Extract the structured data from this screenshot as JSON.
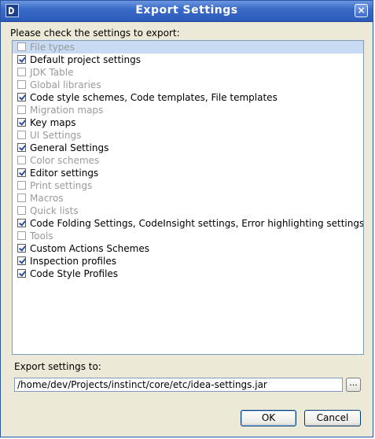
{
  "window": {
    "title": "Export Settings",
    "close_label": "×"
  },
  "prompt": "Please check the settings to export:",
  "settings": [
    {
      "label": "File types",
      "checked": false,
      "enabled": false
    },
    {
      "label": "Default project settings",
      "checked": true,
      "enabled": true
    },
    {
      "label": "JDK Table",
      "checked": false,
      "enabled": false
    },
    {
      "label": "Global libraries",
      "checked": false,
      "enabled": false
    },
    {
      "label": "Code style schemes, Code templates, File templates",
      "checked": true,
      "enabled": true
    },
    {
      "label": "Migration maps",
      "checked": false,
      "enabled": false
    },
    {
      "label": "Key maps",
      "checked": true,
      "enabled": true
    },
    {
      "label": "UI Settings",
      "checked": false,
      "enabled": false
    },
    {
      "label": "General Settings",
      "checked": true,
      "enabled": true
    },
    {
      "label": "Color schemes",
      "checked": false,
      "enabled": false
    },
    {
      "label": "Editor settings",
      "checked": true,
      "enabled": true
    },
    {
      "label": "Print settings",
      "checked": false,
      "enabled": false
    },
    {
      "label": "Macros",
      "checked": false,
      "enabled": false
    },
    {
      "label": "Quick lists",
      "checked": false,
      "enabled": false
    },
    {
      "label": "Code Folding Settings, CodeInsight settings, Error highlighting settings",
      "checked": true,
      "enabled": true
    },
    {
      "label": "Tools",
      "checked": false,
      "enabled": false
    },
    {
      "label": "Custom Actions Schemes",
      "checked": true,
      "enabled": true
    },
    {
      "label": "Inspection profiles",
      "checked": true,
      "enabled": true
    },
    {
      "label": "Code Style Profiles",
      "checked": true,
      "enabled": true
    }
  ],
  "selected_index": 0,
  "export": {
    "label": "Export settings to:",
    "path": "/home/dev/Projects/instinct/core/etc/idea-settings.jar",
    "browse_label": "..."
  },
  "buttons": {
    "ok": "OK",
    "cancel": "Cancel"
  },
  "colors": {
    "titlebar": "#2d5ab8",
    "selection": "#c9dbf3",
    "disabled_text": "#9a9a9a"
  }
}
